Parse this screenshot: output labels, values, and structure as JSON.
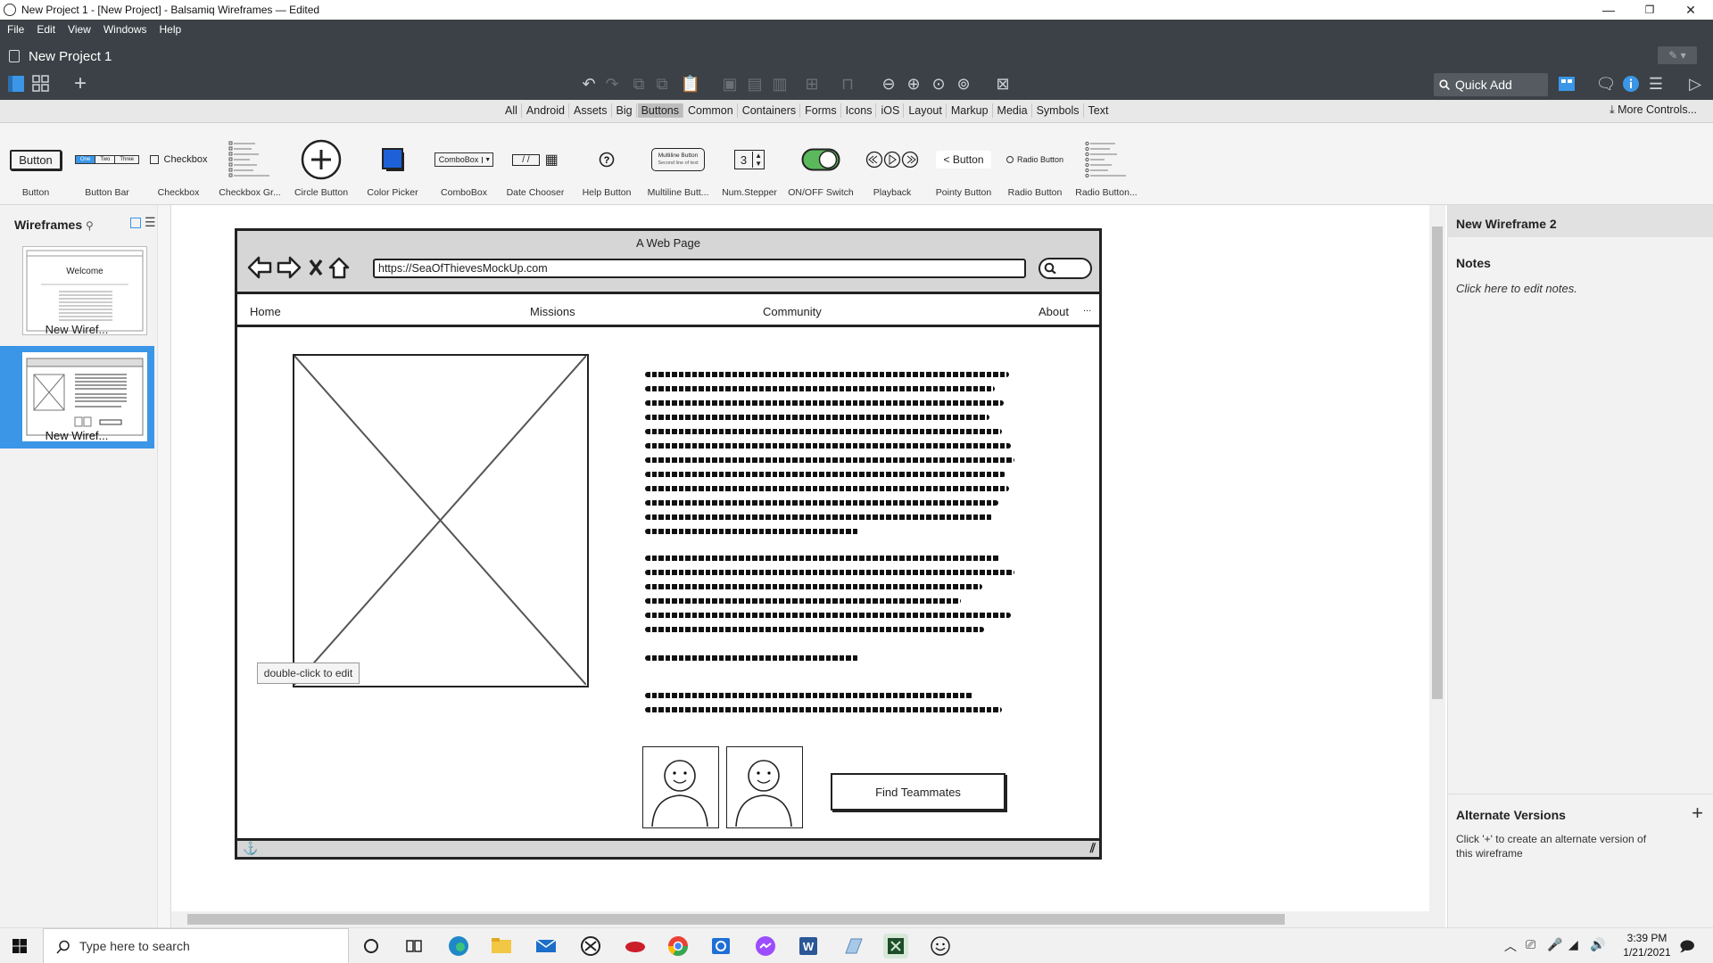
{
  "window": {
    "title": "New Project 1 - [New Project] - Balsamiq Wireframes — Edited",
    "controls": [
      "—",
      "❐",
      "✕"
    ]
  },
  "menu": [
    "File",
    "Edit",
    "View",
    "Windows",
    "Help"
  ],
  "project": {
    "name": "New Project 1"
  },
  "quick_add": {
    "label": "Quick Add"
  },
  "categories": {
    "tabs": [
      "All",
      "Android",
      "Assets",
      "Big",
      "Buttons",
      "Common",
      "Containers",
      "Forms",
      "Icons",
      "iOS",
      "Layout",
      "Markup",
      "Media",
      "Symbols",
      "Text"
    ],
    "active": "Buttons",
    "more": "More Controls..."
  },
  "components": {
    "items": [
      "Button",
      "Button Bar",
      "Checkbox",
      "Checkbox Gr...",
      "Circle Button",
      "Color Picker",
      "ComboBox",
      "Date Chooser",
      "Help Button",
      "Multiline Butt...",
      "Num.Stepper",
      "ON/OFF Switch",
      "Playback",
      "Pointy Button",
      "Radio Button",
      "Radio Button..."
    ],
    "button_text": "Button",
    "buttonbar": [
      "One",
      "Two",
      "Three"
    ],
    "checkbox_text": "Checkbox",
    "combobox_text": "ComboBox",
    "date_text": "/ /",
    "multiline_1": "Multiline Button",
    "multiline_2": "Second line of text",
    "stepper_value": "3",
    "pointy_text": "Button",
    "radio_text": "Radio Button"
  },
  "wireframes": {
    "header": "Wireframes",
    "items": [
      {
        "label": "New Wiref...",
        "thumb_text": "Welcome",
        "selected": false
      },
      {
        "label": "New Wiref...",
        "selected": true
      }
    ]
  },
  "mockup": {
    "page_title": "A Web Page",
    "url": "https://SeaOfThievesMockUp.com",
    "nav": [
      "Home",
      "Missions",
      "Community",
      "About",
      "..."
    ],
    "button_label": "Find Teammates",
    "tooltip": "double-click to edit"
  },
  "inspector": {
    "title": "New Wireframe 2",
    "notes_header": "Notes",
    "notes_text": "Click here to edit notes.",
    "alt_header": "Alternate Versions",
    "alt_text": "Click '+' to create an alternate version of this wireframe"
  },
  "taskbar": {
    "search_placeholder": "Type here to search",
    "time": "3:39 PM",
    "date": "1/21/2021"
  },
  "colors": {
    "chrome_dark": "#3b4146",
    "selection_blue": "#3b96e8",
    "mockup_gray": "#d6d6d6",
    "switch_green": "#5cb85c"
  }
}
